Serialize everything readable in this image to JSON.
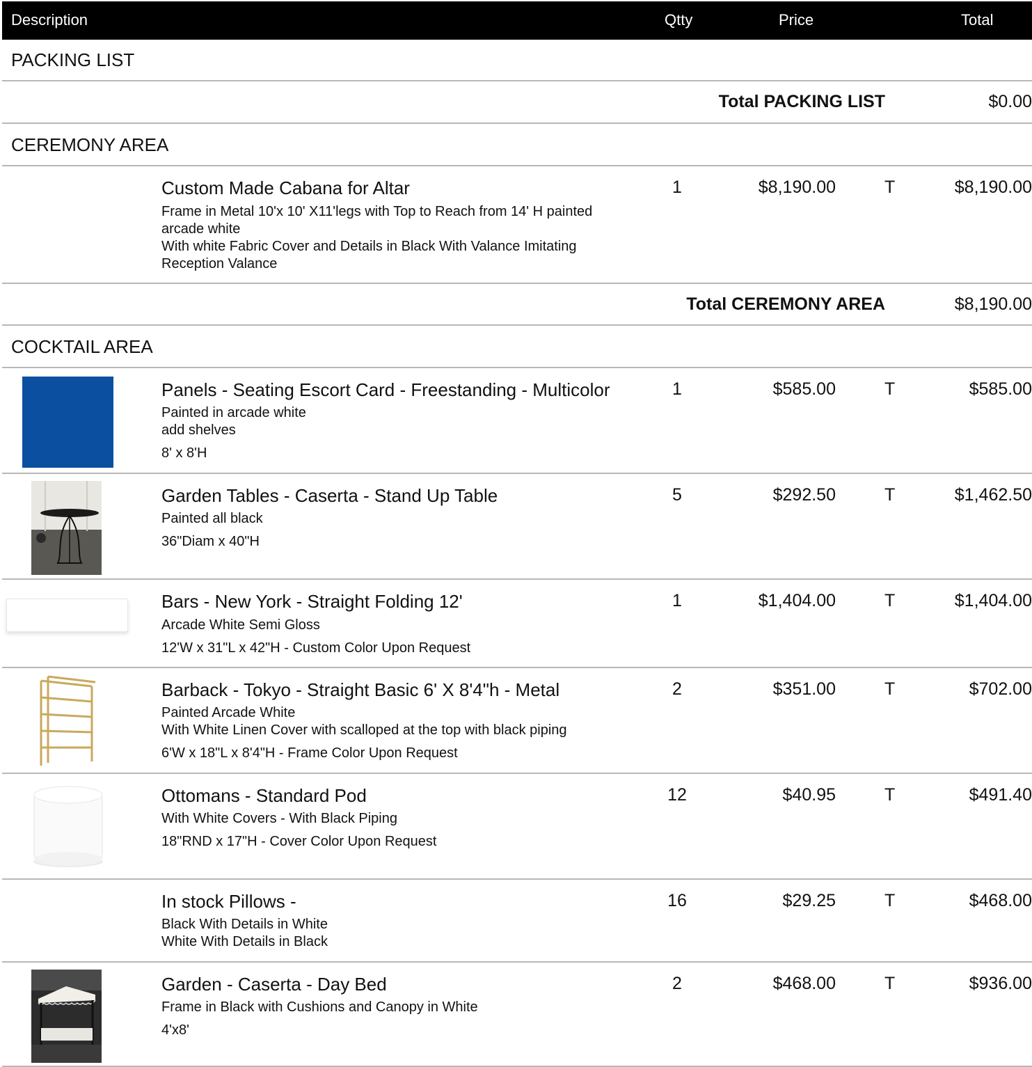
{
  "columns": {
    "description": "Description",
    "qty": "Qtty",
    "price": "Price",
    "total": "Total"
  },
  "sections": [
    {
      "title": "PACKING LIST",
      "subtotal_label": "Total PACKING LIST",
      "subtotal": "$0.00"
    },
    {
      "title": "CEREMONY AREA",
      "subtotal_label": "Total CEREMONY AREA",
      "subtotal": "$8,190.00"
    },
    {
      "title": "COCKTAIL AREA"
    }
  ],
  "items": [
    {
      "name": "Custom Made Cabana for Altar",
      "desc": "Frame in Metal 10'x 10' X11'legs with Top to Reach from 14' H painted arcade white\nWith white Fabric Cover and Details in Black With Valance Imitating Reception Valance",
      "dims": "",
      "qty": "1",
      "price": "$8,190.00",
      "tax": "T",
      "total": "$8,190.00"
    },
    {
      "name": "Panels - Seating Escort Card - Freestanding - Multicolor",
      "desc": "Painted in arcade white\nadd shelves",
      "dims": "8' x 8'H",
      "qty": "1",
      "price": "$585.00",
      "tax": "T",
      "total": "$585.00",
      "thumb": "blue-panel",
      "color": "#0a4fa0"
    },
    {
      "name": "Garden Tables - Caserta - Stand Up Table",
      "desc": "Painted all black",
      "dims": "36\"Diam x 40\"H",
      "qty": "5",
      "price": "$292.50",
      "tax": "T",
      "total": "$1,462.50",
      "thumb": "standup-table"
    },
    {
      "name": "Bars - New York - Straight Folding 12'",
      "desc": "Arcade White Semi Gloss",
      "dims": "12'W x 31\"L x 42\"H - Custom Color Upon Request",
      "qty": "1",
      "price": "$1,404.00",
      "tax": "T",
      "total": "$1,404.00",
      "thumb": "white-bar"
    },
    {
      "name": "Barback - Tokyo - Straight Basic 6' X 8'4\"h -  Metal",
      "desc": "Painted Arcade White\nWith White Linen Cover with scalloped at the top with black piping",
      "dims": "6'W x 18\"L x 8'4\"H - Frame Color Upon Request",
      "qty": "2",
      "price": "$351.00",
      "tax": "T",
      "total": "$702.00",
      "thumb": "shelf-unit"
    },
    {
      "name": "Ottomans - Standard Pod",
      "desc": "With White Covers - With Black Piping",
      "dims": "18\"RND x 17\"H - Cover Color Upon Request",
      "qty": "12",
      "price": "$40.95",
      "tax": "T",
      "total": "$491.40",
      "thumb": "white-ottoman"
    },
    {
      "name": "In stock Pillows -",
      "desc": "Black With Details in White\nWhite With Details in Black",
      "dims": "",
      "qty": "16",
      "price": "$29.25",
      "tax": "T",
      "total": "$468.00"
    },
    {
      "name": "Garden - Caserta - Day Bed",
      "desc": "Frame in Black with Cushions and Canopy in White",
      "dims": "4'x8'",
      "qty": "2",
      "price": "$468.00",
      "tax": "T",
      "total": "$936.00",
      "thumb": "day-bed"
    }
  ]
}
